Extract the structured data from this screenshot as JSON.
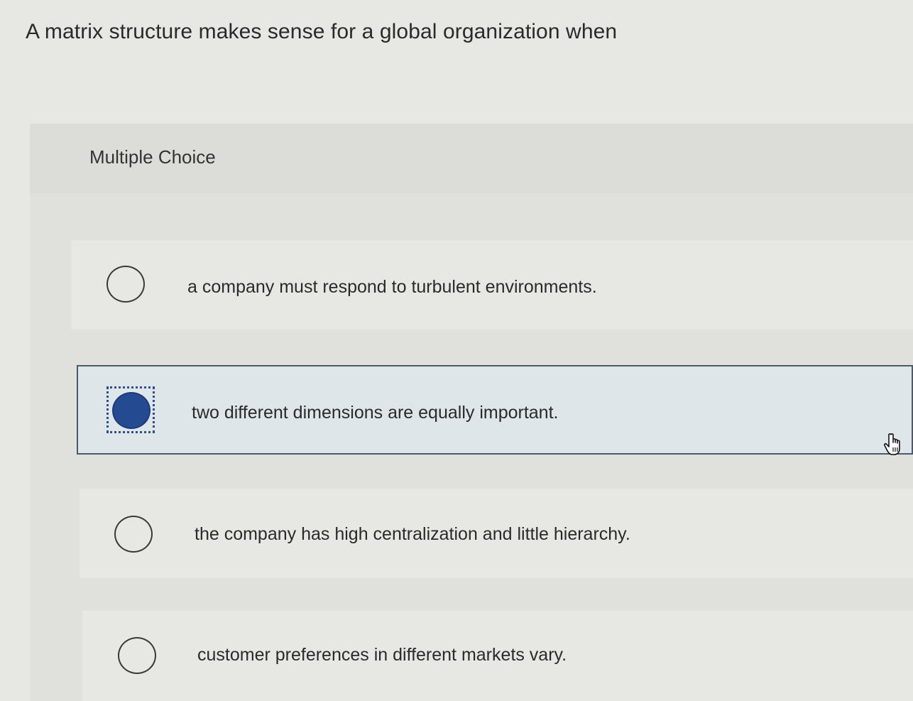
{
  "question": {
    "text": "A matrix structure makes sense for a global organization when"
  },
  "header": {
    "label": "Multiple Choice"
  },
  "options": [
    {
      "text": "a company must respond to turbulent environments.",
      "selected": false
    },
    {
      "text": "two different dimensions are equally important.",
      "selected": true
    },
    {
      "text": "the company has high centralization and little hierarchy.",
      "selected": false
    },
    {
      "text": "customer preferences in different markets vary.",
      "selected": false
    }
  ],
  "colors": {
    "selected_fill": "#244a92",
    "selected_background": "#dfe6ea",
    "page_background": "#e7e8e4"
  },
  "icons": {
    "cursor": "hand-pointer-icon"
  }
}
